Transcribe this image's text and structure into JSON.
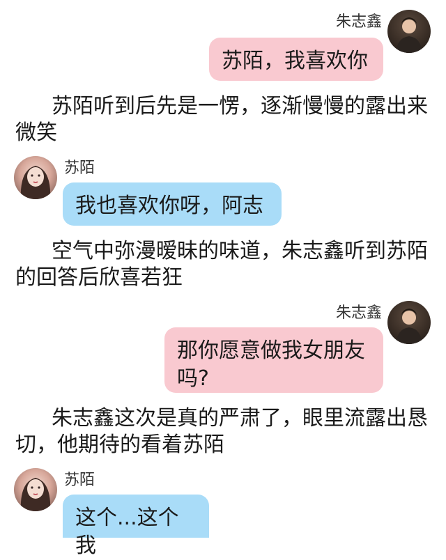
{
  "messages": [
    {
      "speaker": "朱志鑫",
      "text": "苏陌，我喜欢你"
    },
    {
      "narration": "苏陌听到后先是一愣，逐渐慢慢的露出来微笑"
    },
    {
      "speaker": "苏陌",
      "text": "我也喜欢你呀，阿志"
    },
    {
      "narration": "空气中弥漫暧昧的味道，朱志鑫听到苏陌的回答后欣喜若狂"
    },
    {
      "speaker": "朱志鑫",
      "text": "那你愿意做我女朋友吗?"
    },
    {
      "narration": "朱志鑫这次是真的严肃了，眼里流露出恳切，他期待的看着苏陌"
    },
    {
      "speaker": "苏陌",
      "text": "这个...这个我"
    }
  ],
  "colors": {
    "male_bubble": "#f9c9d0",
    "female_bubble": "#a9dcf8"
  },
  "icons": {
    "male_avatar": "avatar-icon",
    "female_avatar": "avatar-icon"
  }
}
